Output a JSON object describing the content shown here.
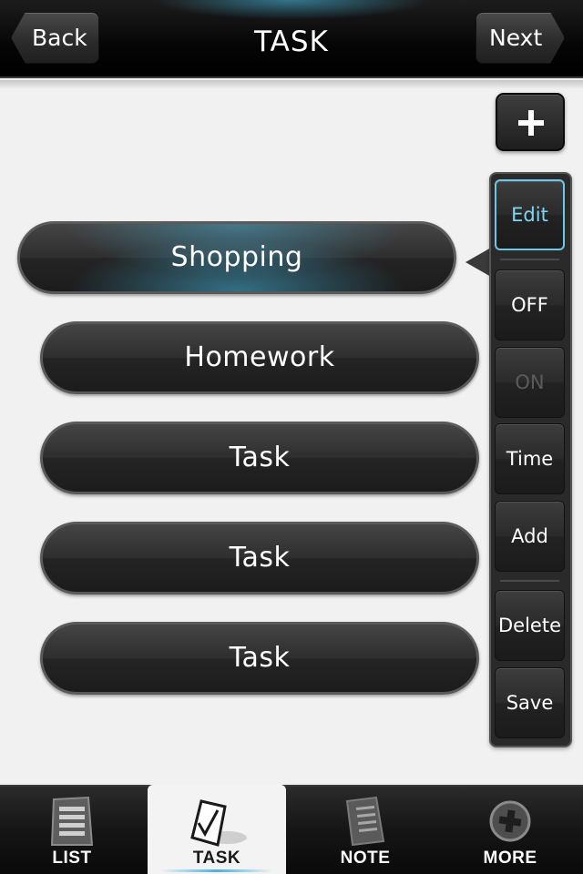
{
  "header": {
    "title": "TASK",
    "back_label": "Back",
    "next_label": "Next"
  },
  "tasks": [
    {
      "label": "Shopping",
      "selected": true
    },
    {
      "label": "Homework",
      "selected": false
    },
    {
      "label": "Task",
      "selected": false
    },
    {
      "label": "Task",
      "selected": false
    },
    {
      "label": "Task",
      "selected": false
    }
  ],
  "side_panel": {
    "buttons": [
      {
        "label": "Edit",
        "state": "active"
      },
      {
        "label": "OFF",
        "state": "normal"
      },
      {
        "label": "ON",
        "state": "disabled"
      },
      {
        "label": "Time",
        "state": "normal"
      },
      {
        "label": "Add",
        "state": "normal"
      },
      {
        "label": "Delete",
        "state": "normal"
      },
      {
        "label": "Save",
        "state": "normal"
      }
    ]
  },
  "tab_bar": {
    "tabs": [
      {
        "label": "LIST",
        "icon": "list-icon",
        "active": false
      },
      {
        "label": "TASK",
        "icon": "task-check-icon",
        "active": true
      },
      {
        "label": "NOTE",
        "icon": "note-icon",
        "active": false
      },
      {
        "label": "MORE",
        "icon": "more-plus-icon",
        "active": false
      }
    ]
  },
  "colors": {
    "accent": "#6cc8e6",
    "background": "#f1f1f1",
    "bar": "#0a0a0a"
  }
}
